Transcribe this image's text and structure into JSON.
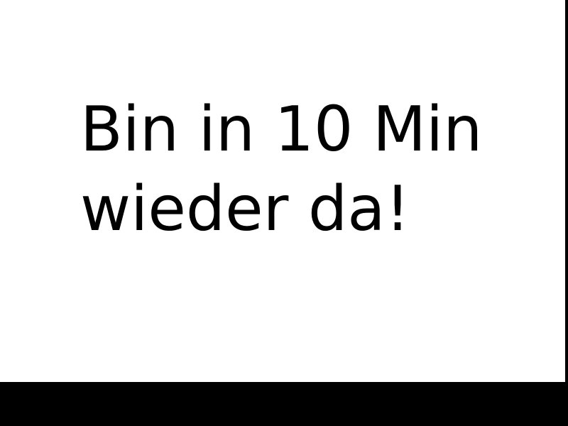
{
  "message": {
    "line1": "Bin in 10 Min",
    "line2": "wieder da!"
  },
  "colors": {
    "background": "#ffffff",
    "text": "#000000",
    "frame": "#000000"
  }
}
